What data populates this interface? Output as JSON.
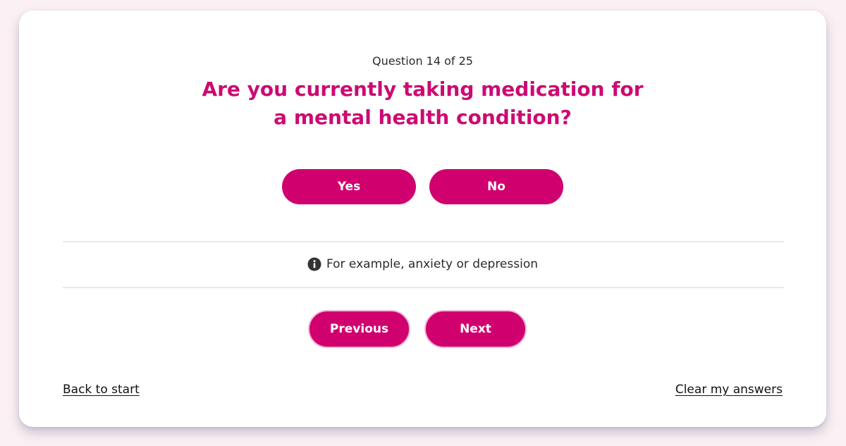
{
  "quiz": {
    "counter": "Question 14 of 25",
    "question": "Are you currently taking medication for a mental health condition?",
    "answers": {
      "yes_label": "Yes",
      "no_label": "No"
    },
    "hint": {
      "icon": "info-icon",
      "text": "For example, anxiety or depression"
    },
    "nav": {
      "previous_label": "Previous",
      "next_label": "Next"
    },
    "footer": {
      "back_label": "Back to start",
      "clear_label": "Clear my answers"
    }
  },
  "colors": {
    "accent": "#d1006f",
    "question_text": "#cc0a73",
    "background": "#fbf0f4",
    "card": "#ffffff"
  }
}
